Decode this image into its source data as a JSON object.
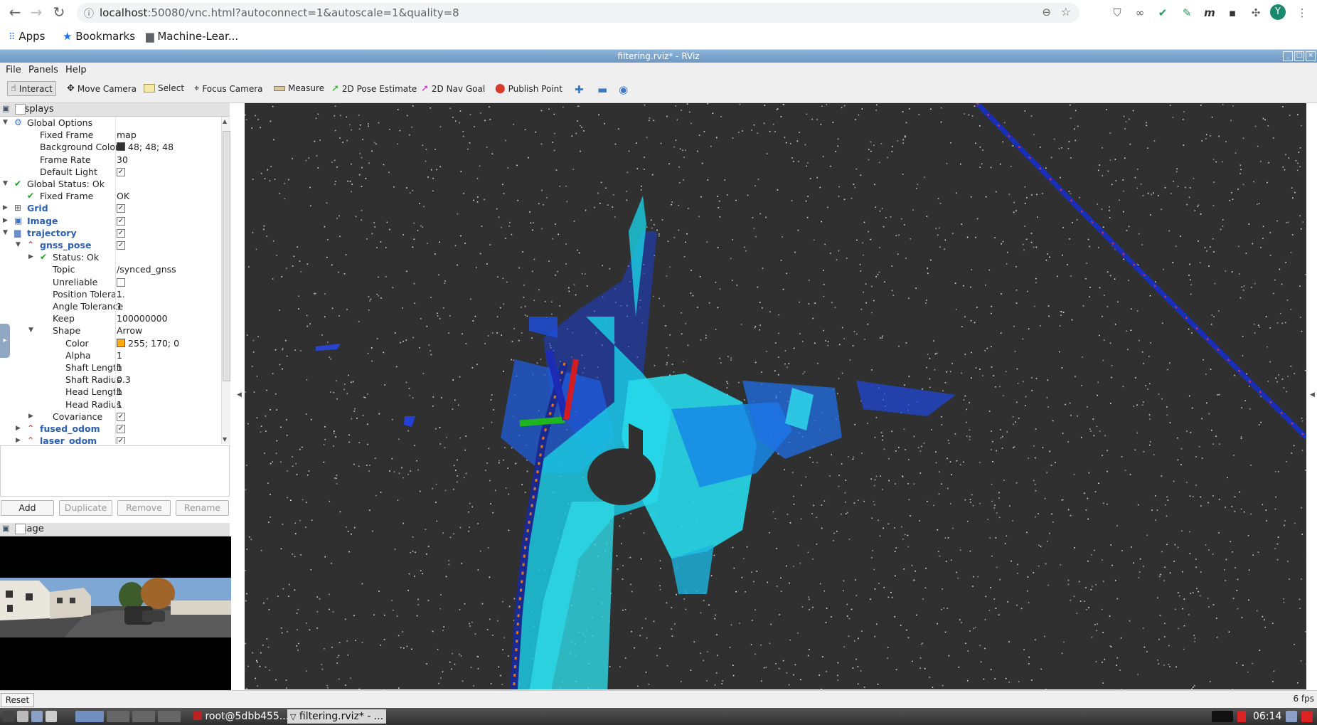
{
  "browser": {
    "url_host": "localhost",
    "url_rest": ":50080/vnc.html?autoconnect=1&autoscale=1&quality=8",
    "bookmarks": [
      {
        "label": "Apps",
        "icon": "apps-grid-icon"
      },
      {
        "label": "Bookmarks",
        "icon": "star-icon"
      },
      {
        "label": "Machine-Lear...",
        "icon": "folder-icon"
      }
    ],
    "profile_initial": "Y"
  },
  "window": {
    "title": "filtering.rviz* - RViz"
  },
  "menu": [
    "File",
    "Panels",
    "Help"
  ],
  "toolbar": {
    "interact": "Interact",
    "move_camera": "Move Camera",
    "select": "Select",
    "focus_camera": "Focus Camera",
    "measure": "Measure",
    "pose_estimate": "2D Pose Estimate",
    "nav_goal": "2D Nav Goal",
    "publish_point": "Publish Point"
  },
  "displays": {
    "title": "Displays",
    "rows": [
      {
        "label": "Global Options",
        "value": ""
      },
      {
        "label": "Fixed Frame",
        "value": "map"
      },
      {
        "label": "Background Color",
        "value": "48; 48; 48",
        "swatch": "#303030"
      },
      {
        "label": "Frame Rate",
        "value": "30"
      },
      {
        "label": "Default Light",
        "value": ""
      },
      {
        "label": "Global Status: Ok",
        "value": ""
      },
      {
        "label": "Fixed Frame",
        "value": "OK"
      },
      {
        "label": "Grid",
        "value": ""
      },
      {
        "label": "Image",
        "value": ""
      },
      {
        "label": "trajectory",
        "value": ""
      },
      {
        "label": "gnss_pose",
        "value": ""
      },
      {
        "label": "Status: Ok",
        "value": ""
      },
      {
        "label": "Topic",
        "value": "/synced_gnss"
      },
      {
        "label": "Unreliable",
        "value": ""
      },
      {
        "label": "Position Tolera...",
        "value": "1"
      },
      {
        "label": "Angle Tolerance",
        "value": "1"
      },
      {
        "label": "Keep",
        "value": "100000000"
      },
      {
        "label": "Shape",
        "value": "Arrow"
      },
      {
        "label": "Color",
        "value": "255; 170; 0",
        "swatch": "#ffaa00"
      },
      {
        "label": "Alpha",
        "value": "1"
      },
      {
        "label": "Shaft Length",
        "value": "1"
      },
      {
        "label": "Shaft Radius",
        "value": "0.3"
      },
      {
        "label": "Head Length",
        "value": "1"
      },
      {
        "label": "Head Radius",
        "value": "1"
      },
      {
        "label": "Covariance",
        "value": ""
      },
      {
        "label": "fused_odom",
        "value": ""
      },
      {
        "label": "laser_odom",
        "value": ""
      }
    ],
    "buttons": {
      "add": "Add",
      "duplicate": "Duplicate",
      "remove": "Remove",
      "rename": "Rename"
    }
  },
  "image_panel": {
    "title": "Image"
  },
  "status": {
    "reset": "Reset",
    "fps": "6 fps"
  },
  "taskbar": {
    "terminal": "root@5dbb455...",
    "rviz": "filtering.rviz* - ...",
    "clock": "06:14"
  }
}
